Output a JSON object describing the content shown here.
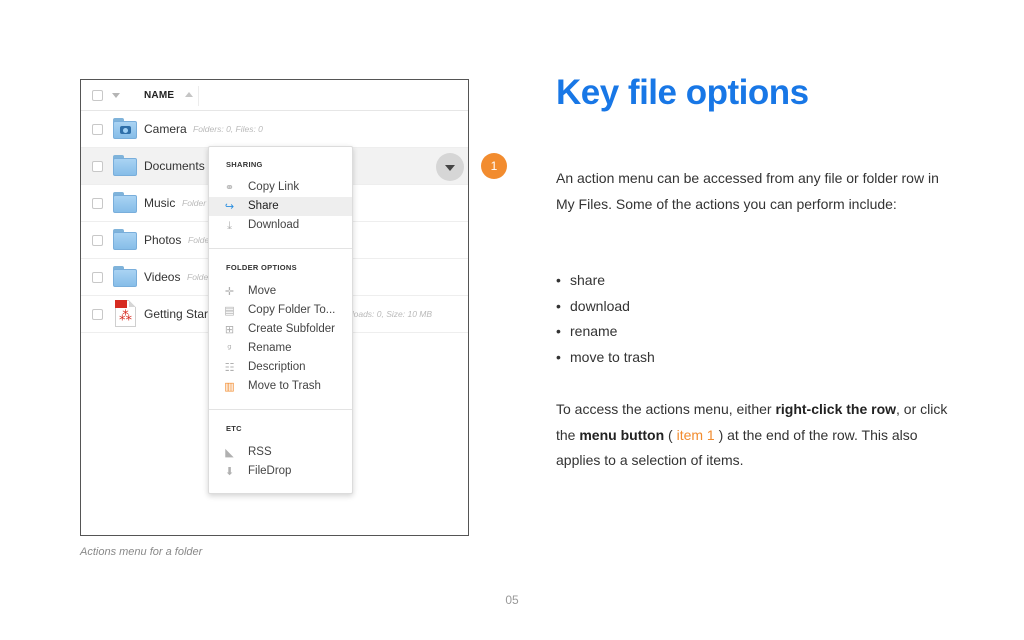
{
  "screenshot": {
    "header": {
      "column_name": "NAME"
    },
    "rows": [
      {
        "name": "Camera",
        "meta": "Folders: 0, Files: 0",
        "icon": "camera-folder-icon"
      },
      {
        "name": "Documents",
        "meta": "",
        "icon": "folder-icon"
      },
      {
        "name": "Music",
        "meta": "Folder",
        "icon": "folder-icon"
      },
      {
        "name": "Photos",
        "meta": "Folde",
        "icon": "folder-icon"
      },
      {
        "name": "Videos",
        "meta": "Folde",
        "icon": "folder-icon"
      },
      {
        "name": "Getting Start",
        "meta": "nloads: 0, Size: 10 MB",
        "icon": "pdf-icon"
      }
    ],
    "menu": {
      "sharing_title": "SHARING",
      "sharing": [
        {
          "label": "Copy Link",
          "icon": "link-icon"
        },
        {
          "label": "Share",
          "icon": "share-icon"
        },
        {
          "label": "Download",
          "icon": "download-icon"
        }
      ],
      "folder_title": "FOLDER OPTIONS",
      "folder": [
        {
          "label": "Move",
          "icon": "move-icon"
        },
        {
          "label": "Copy Folder To...",
          "icon": "copy-folder-icon"
        },
        {
          "label": "Create Subfolder",
          "icon": "create-subfolder-icon"
        },
        {
          "label": "Rename",
          "icon": "rename-icon"
        },
        {
          "label": "Description",
          "icon": "description-icon"
        },
        {
          "label": "Move to Trash",
          "icon": "trash-icon"
        }
      ],
      "etc_title": "ETC",
      "etc": [
        {
          "label": "RSS",
          "icon": "rss-icon"
        },
        {
          "label": "FileDrop",
          "icon": "filedrop-icon"
        }
      ]
    },
    "caption": "Actions menu for a folder"
  },
  "callout": {
    "number": "1"
  },
  "content": {
    "title": "Key file options",
    "intro": "An action menu can be accessed from any file or folder row in My Files. Some of the actions you can perform include:",
    "bullets": [
      "share",
      "download",
      "rename",
      "move to trash"
    ],
    "outro_1": "To access the actions menu, either ",
    "outro_bold_1": "right-click the row",
    "outro_2": ", or click the ",
    "outro_bold_2": "menu button",
    "outro_3": " ( ",
    "outro_item": "item 1",
    "outro_4": " ) at the end of the row. This also applies to a selection of items."
  },
  "page_number": "05",
  "colors": {
    "accent_blue": "#1877e6",
    "accent_orange": "#f28c2f"
  }
}
